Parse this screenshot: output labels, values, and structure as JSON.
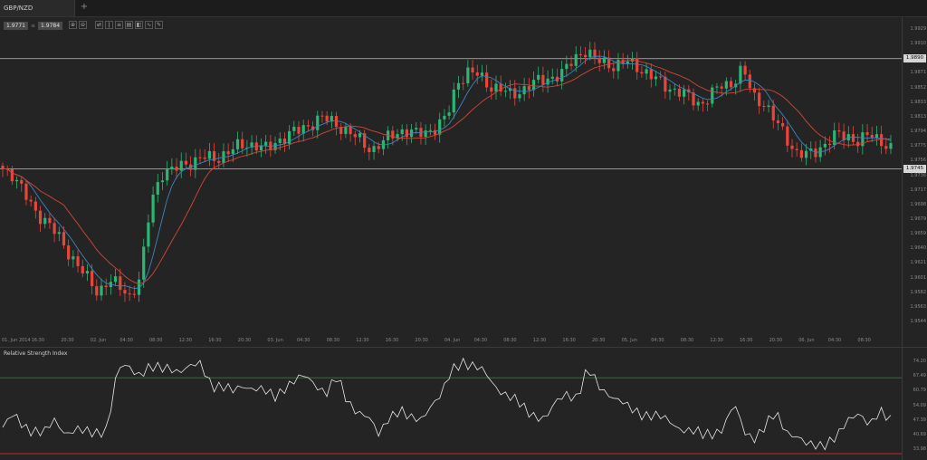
{
  "tab": {
    "title": "GBP/NZD",
    "add_label": "+"
  },
  "quote": {
    "bid": "1.9771",
    "separator": "≡",
    "ask": "1.9784"
  },
  "toolbar": [
    {
      "name": "zoom-in-icon",
      "glyph": "⊕"
    },
    {
      "name": "zoom-out-icon",
      "glyph": "⊖"
    },
    {
      "name": "chart-type-icon",
      "glyph": "⇄"
    },
    {
      "name": "candles-icon",
      "glyph": "ǀ"
    },
    {
      "name": "indicators-icon",
      "glyph": "≡"
    },
    {
      "name": "template-icon",
      "glyph": "▤"
    },
    {
      "name": "screenshot-icon",
      "glyph": "◧"
    },
    {
      "name": "studies-icon",
      "glyph": "∿"
    },
    {
      "name": "draw-icon",
      "glyph": "✎"
    }
  ],
  "price_axis": [
    "1.9929",
    "1.9910",
    "1.9890",
    "1.9871",
    "1.9852",
    "1.9833",
    "1.9813",
    "1.9794",
    "1.9775",
    "1.9756",
    "1.9736",
    "1.9717",
    "1.9698",
    "1.9679",
    "1.9659",
    "1.9640",
    "1.9621",
    "1.9601",
    "1.9582",
    "1.9563",
    "1.9544"
  ],
  "levels": {
    "upper": "1.9890",
    "lower": "1.9745"
  },
  "time_axis": [
    "01. Jun 2014",
    "16:30",
    "20:30",
    "02. Jun",
    "04:30",
    "08:30",
    "12:30",
    "16:30",
    "20:30",
    "03. Jun",
    "04:30",
    "08:30",
    "12:30",
    "16:30",
    "20:30",
    "04. Jun",
    "04:30",
    "08:30",
    "12:30",
    "16:30",
    "20:30",
    "05. Jun",
    "04:30",
    "08:30",
    "12:30",
    "16:30",
    "20:30",
    "06. Jun",
    "04:30",
    "08:30"
  ],
  "rsi": {
    "title": "Relative Strength Index",
    "axis": [
      "74.20",
      "67.49",
      "60.79",
      "54.09",
      "47.39",
      "40.69",
      "33.98"
    ]
  },
  "colors": {
    "up": "#2bb673",
    "down": "#e8463b",
    "ma_fast": "#3a84c0",
    "ma_slow": "#d0473a",
    "rsi_line": "#e6e6e6",
    "rsi_upper": "#2e7d32",
    "rsi_lower": "#c62828"
  },
  "chart_data": {
    "type": "candlestick",
    "close_series": [
      1.9745,
      1.9738,
      1.9712,
      1.969,
      1.9678,
      1.966,
      1.964,
      1.962,
      1.96,
      1.9583,
      1.9598,
      1.959,
      1.9578,
      1.96,
      1.97,
      1.974,
      1.9742,
      1.975,
      1.9755,
      1.976,
      1.9758,
      1.9765,
      1.9772,
      1.9778,
      1.9776,
      1.977,
      1.9782,
      1.979,
      1.9795,
      1.9803,
      1.9812,
      1.9808,
      1.98,
      1.979,
      1.978,
      1.977,
      1.978,
      1.9792,
      1.9796,
      1.979,
      1.9794,
      1.98,
      1.9812,
      1.986,
      1.9872,
      1.9868,
      1.9855,
      1.985,
      1.9842,
      1.9848,
      1.9856,
      1.9862,
      1.9866,
      1.987,
      1.989,
      1.9902,
      1.9888,
      1.9885,
      1.988,
      1.9886,
      1.988,
      1.987,
      1.986,
      1.9852,
      1.9846,
      1.9838,
      1.983,
      1.9842,
      1.9855,
      1.9858,
      1.9876,
      1.984,
      1.9832,
      1.9808,
      1.979,
      1.9766,
      1.9762,
      1.977,
      1.978,
      1.979,
      1.9788,
      1.978,
      1.979,
      1.9784,
      1.977
    ],
    "rsi_series": [
      44,
      49,
      45,
      43,
      41,
      47,
      42,
      43,
      41,
      42,
      44,
      70,
      72,
      69,
      71,
      70,
      72,
      70,
      71,
      73,
      64,
      62,
      60,
      64,
      62,
      60,
      58,
      63,
      65,
      67,
      64,
      60,
      66,
      56,
      52,
      48,
      40,
      50,
      52,
      47,
      48,
      55,
      58,
      70,
      75,
      72,
      69,
      64,
      60,
      56,
      52,
      50,
      48,
      55,
      60,
      58,
      70,
      63,
      60,
      56,
      52,
      51,
      50,
      48,
      46,
      44,
      42,
      40,
      42,
      44,
      54,
      42,
      40,
      44,
      50,
      43,
      40,
      35,
      36,
      38,
      40,
      47,
      52,
      45,
      50,
      48
    ]
  }
}
